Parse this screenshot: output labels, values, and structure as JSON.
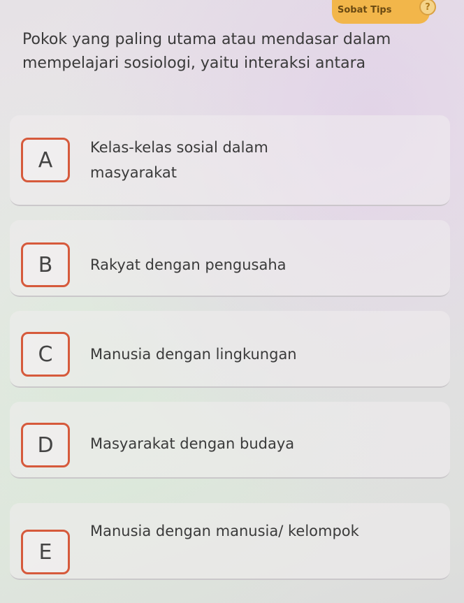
{
  "header": {
    "tips_label": "Sobat Tips",
    "help_symbol": "?"
  },
  "question": {
    "text": "Pokok yang paling utama atau mendasar dalam mempelajari sosiologi, yaitu interaksi antara"
  },
  "options": [
    {
      "letter": "A",
      "text": "Kelas-kelas sosial dalam masyarakat"
    },
    {
      "letter": "B",
      "text": "Rakyat dengan pengusaha"
    },
    {
      "letter": "C",
      "text": "Manusia dengan lingkungan"
    },
    {
      "letter": "D",
      "text": "Masyarakat dengan budaya"
    },
    {
      "letter": "E",
      "text": "Manusia dengan manusia/ kelompok"
    }
  ],
  "colors": {
    "accent": "#f2b64a",
    "letter_border": "#d65a3c"
  }
}
